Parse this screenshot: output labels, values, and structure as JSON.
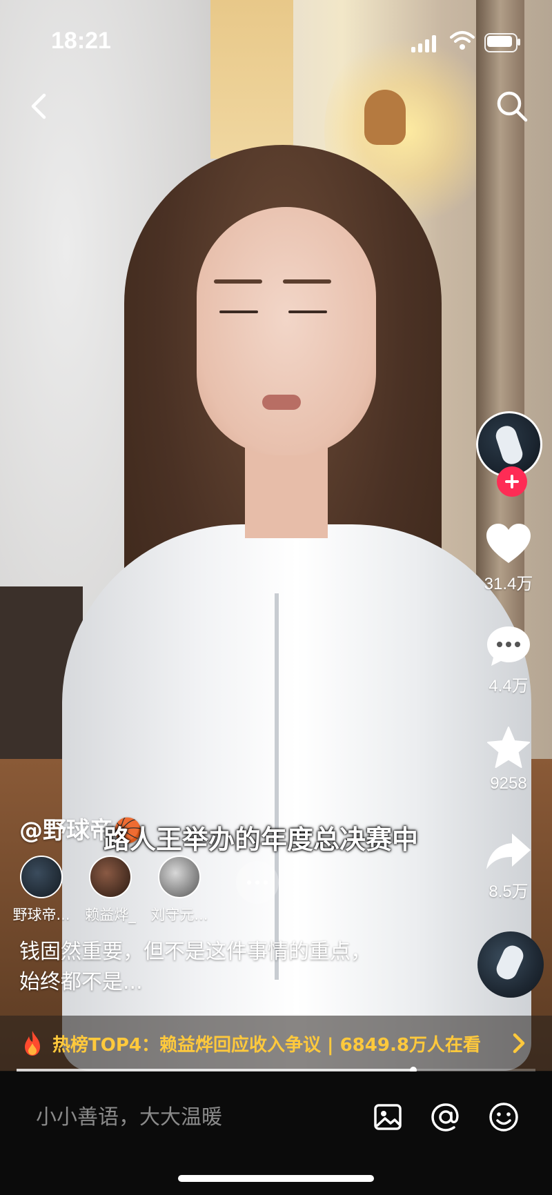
{
  "status_bar": {
    "time": "18:21"
  },
  "author": {
    "handle": "@野球帝",
    "emoji": "🏀"
  },
  "video_subtitle": "路人王举办的年度总决赛中",
  "collaborators": [
    {
      "name": "野球帝..."
    },
    {
      "name": "赖益烨_"
    },
    {
      "name": "刘守元..."
    }
  ],
  "description_lines": [
    "钱固然重要，但不是这件事情的重点，",
    "始终都不是..."
  ],
  "actions": {
    "likes": "31.4万",
    "comments": "4.4万",
    "favorites": "9258",
    "shares": "8.5万"
  },
  "hot_banner": {
    "text": "热榜TOP4：赖益烨回应收入争议 | 6849.8万人在看"
  },
  "playback": {
    "progress": 0.765
  },
  "comment_bar": {
    "placeholder": "小小善语，大大温暖"
  },
  "icons": [
    "back-arrow-icon",
    "search-icon",
    "heart-icon",
    "comment-icon",
    "star-icon",
    "share-icon",
    "flame-icon",
    "chevron-right-icon",
    "image-icon",
    "at-icon",
    "emoji-icon",
    "more-icon",
    "plus-icon"
  ],
  "colors": {
    "follow": "#fe2c55",
    "hot_text": "#ffc93c",
    "bottom_bar": "#0b0b0b"
  }
}
